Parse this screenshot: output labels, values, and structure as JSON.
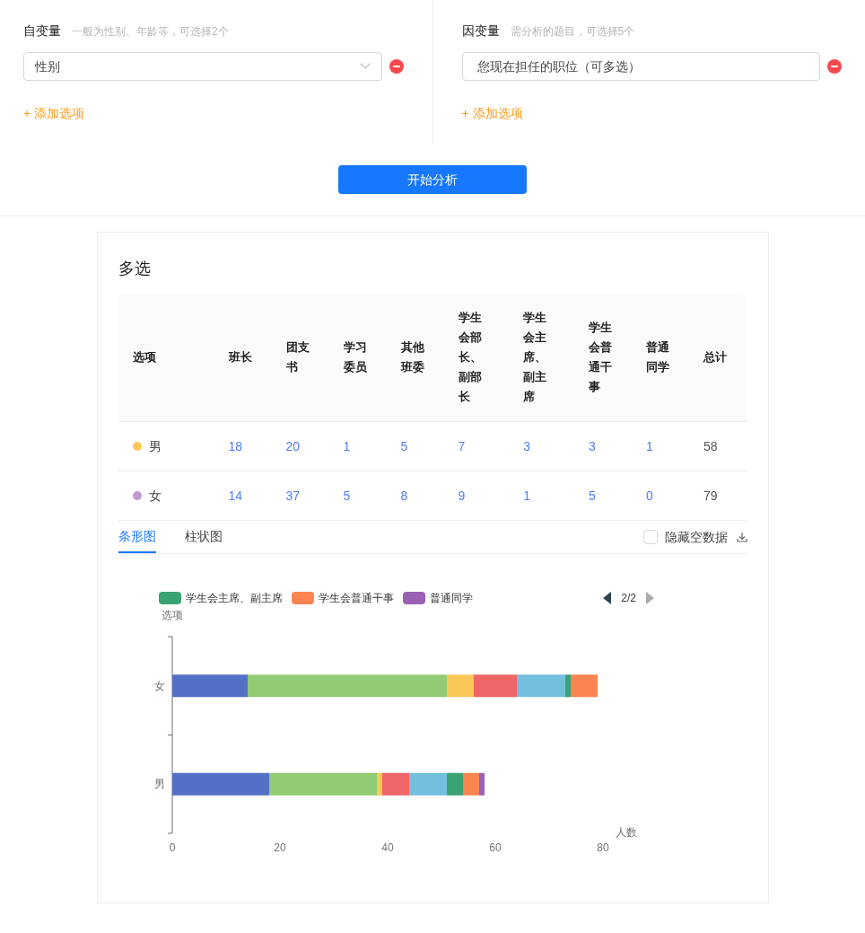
{
  "variables": [
    {
      "title": "自变量",
      "hint": "一般为性别、年龄等，可选择2个",
      "field": {
        "value": "性别",
        "kind": "select"
      },
      "add_label": "+ 添加选项"
    },
    {
      "title": "因变量",
      "hint": "需分析的题目，可选择5个",
      "field": {
        "value": "您现在担任的职位（可多选）",
        "kind": "text"
      },
      "add_label": "+ 添加选项"
    }
  ],
  "start_button": "开始分析",
  "result": {
    "title": "多选",
    "table": {
      "columns": [
        "选项",
        "班长",
        "团支书",
        "学习委员",
        "其他班委",
        "学生会部长、副部长",
        "学生会主席、副主席",
        "学生会普通干事",
        "普通同学",
        "总计"
      ],
      "rows": [
        {
          "color": "#fac858",
          "cells": [
            "男",
            "18",
            "20",
            "1",
            "5",
            "7",
            "3",
            "3",
            "1",
            "58"
          ]
        },
        {
          "color": "#c09ad0",
          "cells": [
            "女",
            "14",
            "37",
            "5",
            "8",
            "9",
            "1",
            "5",
            "0",
            "79"
          ]
        }
      ]
    },
    "tabs": [
      {
        "label": "条形图",
        "selected": true
      },
      {
        "label": "柱状图",
        "selected": false
      }
    ],
    "hide_empty": {
      "label": "隐藏空数据",
      "checked": false
    },
    "legend": {
      "page": "2/2"
    },
    "chart_data": {
      "type": "bar",
      "orientation": "horizontal",
      "stacked": true,
      "xlabel": "人数",
      "ylabel": "选项",
      "categories": [
        "女",
        "男"
      ],
      "xlim": [
        0,
        80
      ],
      "xticks": [
        0,
        20,
        40,
        60,
        80
      ],
      "series": [
        {
          "color": "#5470c6",
          "values": [
            14,
            18
          ]
        },
        {
          "color": "#91cc75",
          "values": [
            37,
            20
          ]
        },
        {
          "color": "#fac858",
          "values": [
            5,
            1
          ]
        },
        {
          "color": "#ee6666",
          "values": [
            8,
            5
          ]
        },
        {
          "color": "#73c0de",
          "values": [
            9,
            7
          ]
        },
        {
          "name": "学生会主席、副主席",
          "color": "#3ba272",
          "values": [
            1,
            3
          ]
        },
        {
          "name": "学生会普通干事",
          "color": "#fc8452",
          "values": [
            5,
            3
          ]
        },
        {
          "name": "普通同学",
          "color": "#9a60b4",
          "values": [
            0,
            1
          ]
        }
      ]
    }
  }
}
